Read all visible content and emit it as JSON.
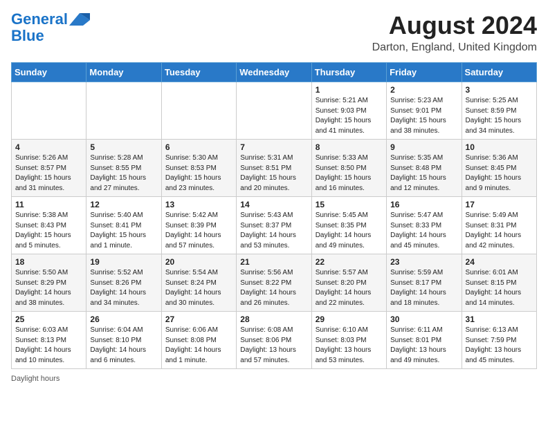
{
  "header": {
    "logo_line1": "General",
    "logo_line2": "Blue",
    "month_title": "August 2024",
    "location": "Darton, England, United Kingdom"
  },
  "days_of_week": [
    "Sunday",
    "Monday",
    "Tuesday",
    "Wednesday",
    "Thursday",
    "Friday",
    "Saturday"
  ],
  "weeks": [
    [
      {
        "day": "",
        "info": ""
      },
      {
        "day": "",
        "info": ""
      },
      {
        "day": "",
        "info": ""
      },
      {
        "day": "",
        "info": ""
      },
      {
        "day": "1",
        "info": "Sunrise: 5:21 AM\nSunset: 9:03 PM\nDaylight: 15 hours and 41 minutes."
      },
      {
        "day": "2",
        "info": "Sunrise: 5:23 AM\nSunset: 9:01 PM\nDaylight: 15 hours and 38 minutes."
      },
      {
        "day": "3",
        "info": "Sunrise: 5:25 AM\nSunset: 8:59 PM\nDaylight: 15 hours and 34 minutes."
      }
    ],
    [
      {
        "day": "4",
        "info": "Sunrise: 5:26 AM\nSunset: 8:57 PM\nDaylight: 15 hours and 31 minutes."
      },
      {
        "day": "5",
        "info": "Sunrise: 5:28 AM\nSunset: 8:55 PM\nDaylight: 15 hours and 27 minutes."
      },
      {
        "day": "6",
        "info": "Sunrise: 5:30 AM\nSunset: 8:53 PM\nDaylight: 15 hours and 23 minutes."
      },
      {
        "day": "7",
        "info": "Sunrise: 5:31 AM\nSunset: 8:51 PM\nDaylight: 15 hours and 20 minutes."
      },
      {
        "day": "8",
        "info": "Sunrise: 5:33 AM\nSunset: 8:50 PM\nDaylight: 15 hours and 16 minutes."
      },
      {
        "day": "9",
        "info": "Sunrise: 5:35 AM\nSunset: 8:48 PM\nDaylight: 15 hours and 12 minutes."
      },
      {
        "day": "10",
        "info": "Sunrise: 5:36 AM\nSunset: 8:45 PM\nDaylight: 15 hours and 9 minutes."
      }
    ],
    [
      {
        "day": "11",
        "info": "Sunrise: 5:38 AM\nSunset: 8:43 PM\nDaylight: 15 hours and 5 minutes."
      },
      {
        "day": "12",
        "info": "Sunrise: 5:40 AM\nSunset: 8:41 PM\nDaylight: 15 hours and 1 minute."
      },
      {
        "day": "13",
        "info": "Sunrise: 5:42 AM\nSunset: 8:39 PM\nDaylight: 14 hours and 57 minutes."
      },
      {
        "day": "14",
        "info": "Sunrise: 5:43 AM\nSunset: 8:37 PM\nDaylight: 14 hours and 53 minutes."
      },
      {
        "day": "15",
        "info": "Sunrise: 5:45 AM\nSunset: 8:35 PM\nDaylight: 14 hours and 49 minutes."
      },
      {
        "day": "16",
        "info": "Sunrise: 5:47 AM\nSunset: 8:33 PM\nDaylight: 14 hours and 45 minutes."
      },
      {
        "day": "17",
        "info": "Sunrise: 5:49 AM\nSunset: 8:31 PM\nDaylight: 14 hours and 42 minutes."
      }
    ],
    [
      {
        "day": "18",
        "info": "Sunrise: 5:50 AM\nSunset: 8:29 PM\nDaylight: 14 hours and 38 minutes."
      },
      {
        "day": "19",
        "info": "Sunrise: 5:52 AM\nSunset: 8:26 PM\nDaylight: 14 hours and 34 minutes."
      },
      {
        "day": "20",
        "info": "Sunrise: 5:54 AM\nSunset: 8:24 PM\nDaylight: 14 hours and 30 minutes."
      },
      {
        "day": "21",
        "info": "Sunrise: 5:56 AM\nSunset: 8:22 PM\nDaylight: 14 hours and 26 minutes."
      },
      {
        "day": "22",
        "info": "Sunrise: 5:57 AM\nSunset: 8:20 PM\nDaylight: 14 hours and 22 minutes."
      },
      {
        "day": "23",
        "info": "Sunrise: 5:59 AM\nSunset: 8:17 PM\nDaylight: 14 hours and 18 minutes."
      },
      {
        "day": "24",
        "info": "Sunrise: 6:01 AM\nSunset: 8:15 PM\nDaylight: 14 hours and 14 minutes."
      }
    ],
    [
      {
        "day": "25",
        "info": "Sunrise: 6:03 AM\nSunset: 8:13 PM\nDaylight: 14 hours and 10 minutes."
      },
      {
        "day": "26",
        "info": "Sunrise: 6:04 AM\nSunset: 8:10 PM\nDaylight: 14 hours and 6 minutes."
      },
      {
        "day": "27",
        "info": "Sunrise: 6:06 AM\nSunset: 8:08 PM\nDaylight: 14 hours and 1 minute."
      },
      {
        "day": "28",
        "info": "Sunrise: 6:08 AM\nSunset: 8:06 PM\nDaylight: 13 hours and 57 minutes."
      },
      {
        "day": "29",
        "info": "Sunrise: 6:10 AM\nSunset: 8:03 PM\nDaylight: 13 hours and 53 minutes."
      },
      {
        "day": "30",
        "info": "Sunrise: 6:11 AM\nSunset: 8:01 PM\nDaylight: 13 hours and 49 minutes."
      },
      {
        "day": "31",
        "info": "Sunrise: 6:13 AM\nSunset: 7:59 PM\nDaylight: 13 hours and 45 minutes."
      }
    ]
  ],
  "footer": {
    "note": "Daylight hours"
  }
}
